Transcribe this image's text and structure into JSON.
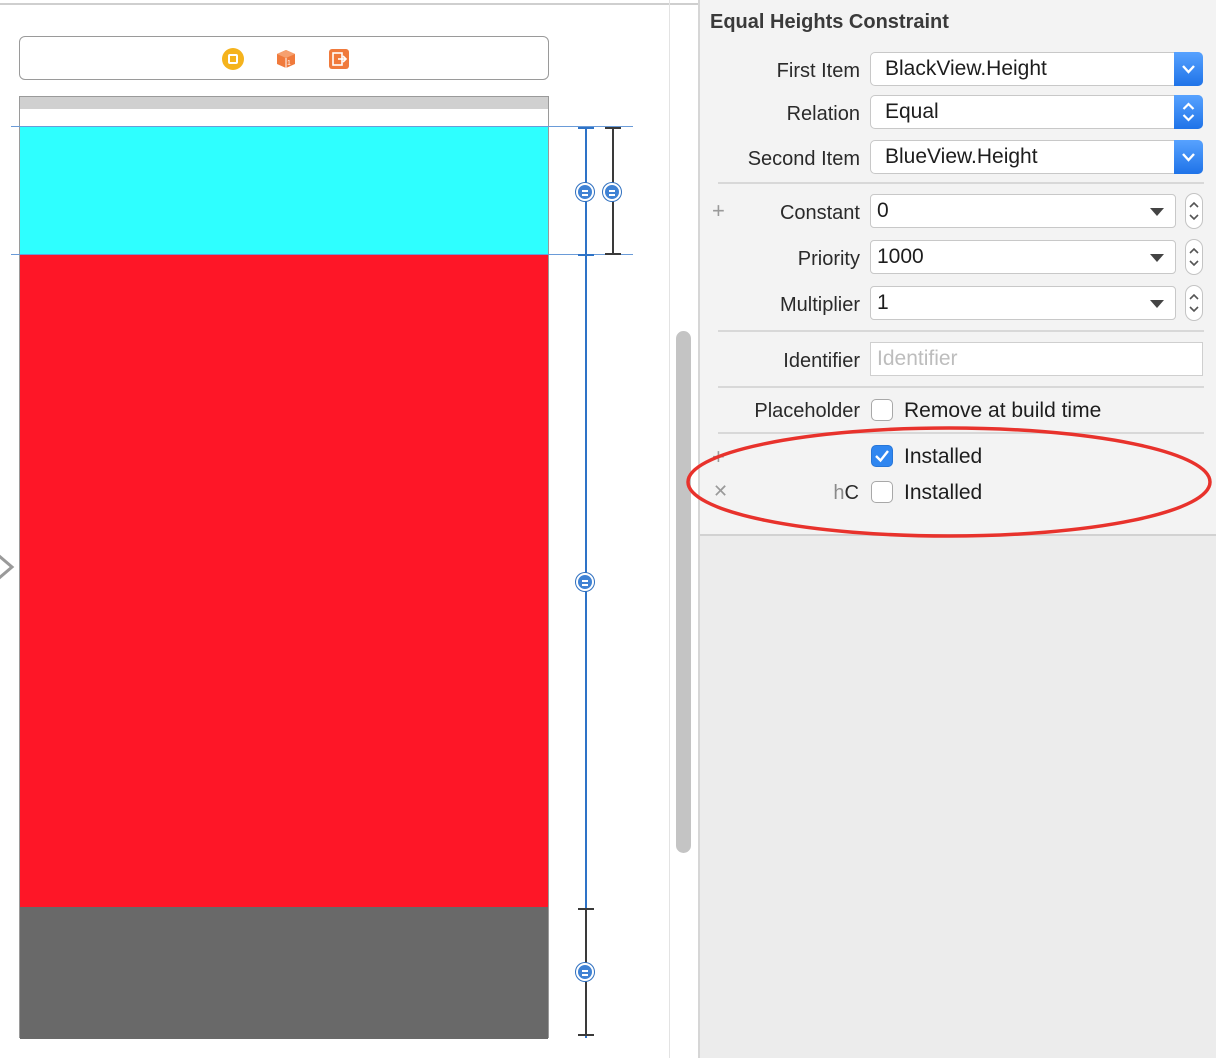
{
  "inspector": {
    "title": "Equal Heights Constraint",
    "first_item": {
      "label": "First Item",
      "value": "BlackView.Height"
    },
    "relation": {
      "label": "Relation",
      "value": "Equal"
    },
    "second_item": {
      "label": "Second Item",
      "value": "BlueView.Height"
    },
    "constant": {
      "label": "Constant",
      "value": "0"
    },
    "priority": {
      "label": "Priority",
      "value": "1000"
    },
    "multiplier": {
      "label": "Multiplier",
      "value": "1"
    },
    "identifier": {
      "label": "Identifier",
      "value": "",
      "placeholder": "Identifier"
    },
    "placeholder": {
      "label": "Placeholder",
      "checkbox_label": "Remove at build time",
      "checked": false
    },
    "installed_rows": [
      {
        "size_class_prefix": "",
        "size_class": "",
        "label": "Installed",
        "checked": true
      },
      {
        "size_class_prefix": "h",
        "size_class": "C",
        "label": "Installed",
        "checked": false
      }
    ]
  },
  "canvas": {
    "views": [
      {
        "name": "status-bar",
        "color": "#d0d0d0"
      },
      {
        "name": "blue-view",
        "color": "#2effff"
      },
      {
        "name": "red-view",
        "color": "#fe1627"
      },
      {
        "name": "black-view",
        "color": "#696969"
      }
    ],
    "scene_dock_icons": [
      "view-controller-icon",
      "first-responder-icon",
      "exit-icon"
    ]
  },
  "colors": {
    "accent": "#2f86f0",
    "annotation": "#e8322c",
    "constraint": "#2e73c7"
  }
}
